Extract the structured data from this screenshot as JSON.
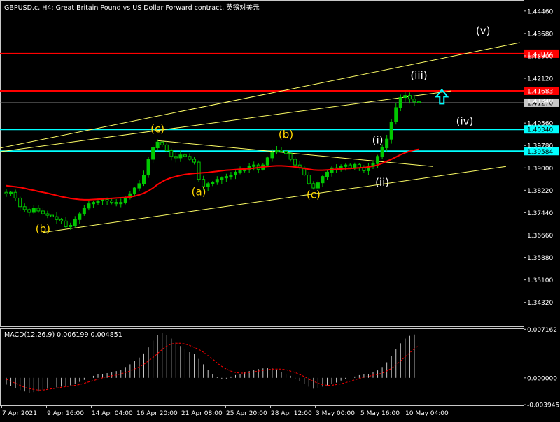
{
  "chart_data": {
    "type": "candlestick",
    "title": "GBPUSD.c, H4:  Great Britain Pound vs US Dollar Forward contract, 英镑对美元",
    "colors": {
      "background": "#000000",
      "grid_border": "#c8c8c8",
      "bull_candle": "#00c800",
      "moving_average": "#ff0000",
      "trend_lines": "#ffff66",
      "resistance_lines": "#ff0000",
      "support_lines": "#00ffff",
      "price_label_current": "#c8c8c8",
      "wave_labels_yellow": "#ffd700",
      "wave_labels_white": "#ffffff",
      "macd_histogram": "#c8c8c8",
      "macd_signal": "#ff0000",
      "arrow": "#00ffff"
    },
    "price_axis": {
      "ylim": [
        1.33485,
        1.44845
      ],
      "ticks": [
        "1.44460",
        "1.43680",
        "1.42900",
        "1.42120",
        "1.41340",
        "1.40560",
        "1.39780",
        "1.39000",
        "1.38220",
        "1.37440",
        "1.36660",
        "1.35880",
        "1.35100",
        "1.34320"
      ]
    },
    "time_axis": {
      "ticks": [
        "7 Apr 2021",
        "9 Apr 16:00",
        "14 Apr 04:00",
        "16 Apr 20:00",
        "21 Apr 08:00",
        "25 Apr 20:00",
        "28 Apr 12:00",
        "3 May 00:00",
        "5 May 16:00",
        "10 May 04:00"
      ]
    },
    "horizontal_levels": [
      {
        "label": "1.42974",
        "value": 1.42974,
        "color": "#ff0000"
      },
      {
        "label": "1.41683",
        "value": 1.41683,
        "color": "#ff0000"
      },
      {
        "label": "1.40340",
        "value": 1.4034,
        "color": "#00ffff"
      },
      {
        "label": "1.39584",
        "value": 1.39584,
        "color": "#00ffff"
      }
    ],
    "current_price": {
      "label": "1.41270",
      "value": 1.4127
    },
    "series": [
      {
        "name": "GBPUSD close (H4)",
        "values": [
          1.381,
          1.3815,
          1.3795,
          1.3765,
          1.3755,
          1.3745,
          1.376,
          1.375,
          1.374,
          1.3735,
          1.373,
          1.372,
          1.3715,
          1.3695,
          1.37,
          1.372,
          1.374,
          1.376,
          1.3775,
          1.378,
          1.3785,
          1.379,
          1.3785,
          1.378,
          1.3775,
          1.378,
          1.3795,
          1.381,
          1.383,
          1.3845,
          1.3875,
          1.393,
          1.397,
          1.399,
          1.398,
          1.396,
          1.394,
          1.3935,
          1.3945,
          1.394,
          1.393,
          1.392,
          1.386,
          1.3835,
          1.3845,
          1.385,
          1.386,
          1.3865,
          1.387,
          1.3875,
          1.3885,
          1.389,
          1.3895,
          1.3905,
          1.391,
          1.3895,
          1.391,
          1.3935,
          1.3955,
          1.3962,
          1.3958,
          1.395,
          1.393,
          1.391,
          1.39,
          1.3875,
          1.3845,
          1.383,
          1.3848,
          1.387,
          1.3885,
          1.39,
          1.3895,
          1.3905,
          1.391,
          1.39,
          1.3912,
          1.39,
          1.389,
          1.3905,
          1.3915,
          1.394,
          1.397,
          1.4,
          1.406,
          1.411,
          1.4145,
          1.4152,
          1.414,
          1.413,
          1.4127
        ]
      },
      {
        "name": "Moving average",
        "values": [
          1.3838,
          1.3836,
          1.3834,
          1.3832,
          1.3829,
          1.3825,
          1.3822,
          1.3818,
          1.3815,
          1.3812,
          1.3808,
          1.3804,
          1.38,
          1.3797,
          1.3794,
          1.3792,
          1.379,
          1.3789,
          1.3789,
          1.379,
          1.3791,
          1.3792,
          1.3793,
          1.3794,
          1.3795,
          1.3796,
          1.3797,
          1.3799,
          1.3802,
          1.3806,
          1.3812,
          1.382,
          1.383,
          1.3842,
          1.3852,
          1.386,
          1.3866,
          1.387,
          1.3874,
          1.3877,
          1.3879,
          1.3881,
          1.3882,
          1.3883,
          1.3884,
          1.3886,
          1.3888,
          1.389,
          1.3892,
          1.3893,
          1.3894,
          1.3895,
          1.3896,
          1.3897,
          1.3899,
          1.3901,
          1.3903,
          1.3905,
          1.3906,
          1.3907,
          1.3907,
          1.3906,
          1.3905,
          1.3903,
          1.3901,
          1.3898,
          1.3895,
          1.3893,
          1.3892,
          1.3892,
          1.3893,
          1.3894,
          1.3895,
          1.3896,
          1.3897,
          1.3898,
          1.3899,
          1.39,
          1.3901,
          1.3903,
          1.3906,
          1.391,
          1.3916,
          1.3923,
          1.393,
          1.3938,
          1.3946,
          1.3953,
          1.3958,
          1.3962,
          1.3965
        ]
      }
    ],
    "wave_labels": [
      {
        "text": "(b)",
        "bar": 8,
        "price": 1.3676,
        "color": "#ffd700"
      },
      {
        "text": "(c)",
        "bar": 33,
        "price": 1.4024,
        "color": "#ffd700"
      },
      {
        "text": "(a)",
        "bar": 42,
        "price": 1.3805,
        "color": "#ffd700"
      },
      {
        "text": "(b)",
        "bar": 61,
        "price": 1.4004,
        "color": "#ffd700"
      },
      {
        "text": "(c)",
        "bar": 67,
        "price": 1.3795,
        "color": "#ffd700"
      },
      {
        "text": "(i)",
        "bar": 81,
        "price": 1.3985,
        "color": "#ffffff"
      },
      {
        "text": "(ii)",
        "bar": 82,
        "price": 1.3838,
        "color": "#ffffff"
      },
      {
        "text": "(iii)",
        "bar": 90,
        "price": 1.421,
        "color": "#ffffff"
      },
      {
        "text": "(iv)",
        "bar": 100,
        "price": 1.405,
        "color": "#ffffff"
      },
      {
        "text": "(v)",
        "bar": 104,
        "price": 1.4365,
        "color": "#ffffff"
      }
    ],
    "trend_lines": [
      {
        "from": {
          "bar": -2,
          "price": 1.3955
        },
        "to": {
          "bar": 97,
          "price": 1.4168
        }
      },
      {
        "from": {
          "bar": -2,
          "price": 1.3967
        },
        "to": {
          "bar": 112,
          "price": 1.4336
        }
      },
      {
        "from": {
          "bar": 8,
          "price": 1.3675
        },
        "to": {
          "bar": 109,
          "price": 1.3905
        }
      },
      {
        "from": {
          "bar": 33,
          "price": 1.3995
        },
        "to": {
          "bar": 93,
          "price": 1.3905
        }
      }
    ],
    "macd": {
      "label": "MACD(12,26,9) 0.006199 0.004851",
      "params": [
        12,
        26,
        9
      ],
      "value": 0.006199,
      "signal": 0.004851,
      "ylim": [
        -0.00404,
        0.0073
      ],
      "ticks": [
        "0.007162",
        "0.000000",
        "-0.003945"
      ],
      "histogram": [
        -0.001,
        -0.0012,
        -0.0015,
        -0.0018,
        -0.002,
        -0.0022,
        -0.0021,
        -0.002,
        -0.0018,
        -0.0016,
        -0.0015,
        -0.0014,
        -0.0013,
        -0.0012,
        -0.0011,
        -0.0009,
        -0.0006,
        -0.0003,
        0.0,
        0.0003,
        0.0005,
        0.0006,
        0.0007,
        0.0008,
        0.001,
        0.0012,
        0.0016,
        0.002,
        0.0025,
        0.003,
        0.0036,
        0.0045,
        0.0055,
        0.0063,
        0.0066,
        0.0063,
        0.0058,
        0.0052,
        0.0047,
        0.0042,
        0.0038,
        0.0035,
        0.0028,
        0.002,
        0.0012,
        0.0006,
        0.0001,
        -0.0002,
        -0.0001,
        0.0002,
        0.0004,
        0.0006,
        0.0008,
        0.001,
        0.0012,
        0.0013,
        0.0014,
        0.0015,
        0.0014,
        0.0012,
        0.0009,
        0.0006,
        0.0003,
        -0.0001,
        -0.0005,
        -0.0009,
        -0.0013,
        -0.0016,
        -0.0015,
        -0.0013,
        -0.0011,
        -0.0009,
        -0.0007,
        -0.0004,
        -0.0002,
        0.0,
        0.0002,
        0.0004,
        0.0005,
        0.0006,
        0.0008,
        0.0011,
        0.0016,
        0.0023,
        0.0032,
        0.0042,
        0.0051,
        0.0058,
        0.0062,
        0.0064,
        0.0065
      ],
      "signal_line": [
        -0.0002,
        -0.0005,
        -0.0008,
        -0.0011,
        -0.0014,
        -0.0016,
        -0.0017,
        -0.0018,
        -0.0018,
        -0.0017,
        -0.0016,
        -0.0015,
        -0.0014,
        -0.0013,
        -0.0012,
        -0.0011,
        -0.001,
        -0.0008,
        -0.0006,
        -0.0004,
        -0.0002,
        0.0,
        0.0002,
        0.0003,
        0.0004,
        0.0006,
        0.0008,
        0.001,
        0.0013,
        0.0016,
        0.002,
        0.0025,
        0.003,
        0.0036,
        0.0042,
        0.0047,
        0.005,
        0.0051,
        0.0051,
        0.005,
        0.0048,
        0.0045,
        0.0042,
        0.0038,
        0.0033,
        0.0028,
        0.0022,
        0.0017,
        0.0013,
        0.001,
        0.0008,
        0.0007,
        0.0007,
        0.0008,
        0.0009,
        0.001,
        0.0011,
        0.0012,
        0.0013,
        0.0013,
        0.0013,
        0.0012,
        0.001,
        0.0008,
        0.0005,
        0.0002,
        -0.0002,
        -0.0005,
        -0.0008,
        -0.001,
        -0.0011,
        -0.0011,
        -0.001,
        -0.0009,
        -0.0007,
        -0.0005,
        -0.0003,
        -0.0001,
        0.0001,
        0.0002,
        0.0004,
        0.0005,
        0.0007,
        0.001,
        0.0014,
        0.0019,
        0.0025,
        0.0031,
        0.0037,
        0.0043,
        0.0048
      ]
    }
  }
}
